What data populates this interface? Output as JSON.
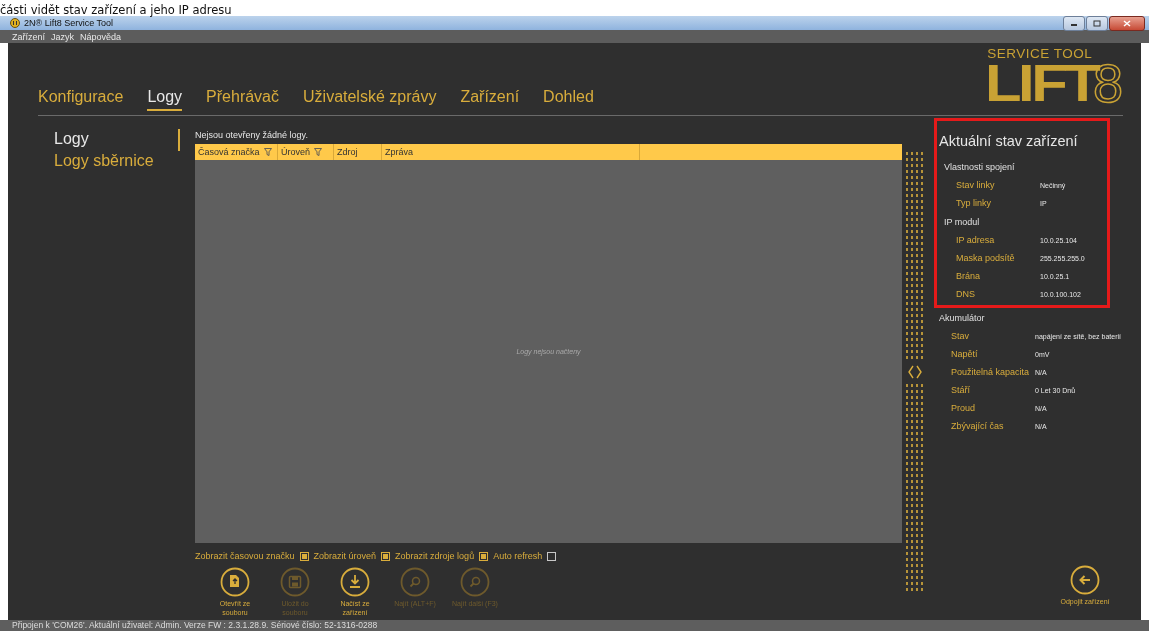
{
  "caption": "části vidět stav zařízení a jeho IP adresu",
  "window": {
    "title": "2N® Lift8 Service Tool"
  },
  "menu": [
    "Zařízení",
    "Jazyk",
    "Nápověda"
  ],
  "tabs": [
    {
      "label": "Konfigurace",
      "selected": false
    },
    {
      "label": "Logy",
      "selected": true
    },
    {
      "label": "Přehrávač",
      "selected": false
    },
    {
      "label": "Uživatelské zprávy",
      "selected": false
    },
    {
      "label": "Zařízení",
      "selected": false
    },
    {
      "label": "Dohled",
      "selected": false
    }
  ],
  "logo": {
    "subtitle": "SERVICE TOOL",
    "word": "LIFT",
    "number": "8"
  },
  "sidebar": {
    "items": [
      {
        "label": "Logy",
        "selected": true
      },
      {
        "label": "Logy sběrnice",
        "selected": false
      }
    ]
  },
  "log": {
    "message": "Nejsou otevřeny žádné logy.",
    "columns": [
      {
        "label": "Časová značka",
        "filter": true
      },
      {
        "label": "Úroveň",
        "filter": true
      },
      {
        "label": "Zdroj",
        "filter": false
      },
      {
        "label": "Zpráva",
        "filter": false
      }
    ],
    "empty_text": "Logy nejsou načteny",
    "options": [
      {
        "label": "Zobrazit časovou značku",
        "checked": true
      },
      {
        "label": "Zobrazit úroveň",
        "checked": true
      },
      {
        "label": "Zobrazit zdroje logů",
        "checked": true
      },
      {
        "label": "Auto refresh",
        "checked": false
      }
    ],
    "actions": [
      {
        "kind": "open",
        "label": "Otevřít ze souboru",
        "disabled": false
      },
      {
        "kind": "save",
        "label": "Uložit do souboru",
        "disabled": true
      },
      {
        "kind": "download",
        "label": "Načíst ze zařízení",
        "disabled": false
      },
      {
        "kind": "search",
        "label": "Najít (ALT+F)",
        "disabled": true
      },
      {
        "kind": "search",
        "label": "Najít další (F3)",
        "disabled": true
      }
    ]
  },
  "panel": {
    "title": "Aktuální stav zařízení",
    "sections": [
      {
        "title": "Vlastnosti spojení",
        "highlighted": true,
        "rows": [
          {
            "label": "Stav linky",
            "value": "Nečinný"
          },
          {
            "label": "Typ linky",
            "value": "IP"
          }
        ]
      },
      {
        "title": "IP modul",
        "highlighted": true,
        "rows": [
          {
            "label": "IP adresa",
            "value": "10.0.25.104"
          },
          {
            "label": "Maska podsítě",
            "value": "255.255.255.0"
          },
          {
            "label": "Brána",
            "value": "10.0.25.1"
          },
          {
            "label": "DNS",
            "value": "10.0.100.102"
          }
        ]
      },
      {
        "title": "Akumulátor",
        "highlighted": false,
        "rows": [
          {
            "label": "Stav",
            "value": "napájení ze sítě, bez baterií"
          },
          {
            "label": "Napětí",
            "value": "0mV"
          },
          {
            "label": "Použitelná kapacita",
            "value": "N/A"
          },
          {
            "label": "Stáří",
            "value": "0 Let 30 Dnů"
          },
          {
            "label": "Proud",
            "value": "N/A"
          },
          {
            "label": "Zbývající čas",
            "value": "N/A"
          }
        ]
      }
    ]
  },
  "disconnect": {
    "label": "Odpojit zařízení"
  },
  "status_bar": "Připojen k 'COM26'. Aktuální uživatel: Admin. Verze FW : 2.3.1.28.9. Sériové číslo: 52-1316-0288"
}
